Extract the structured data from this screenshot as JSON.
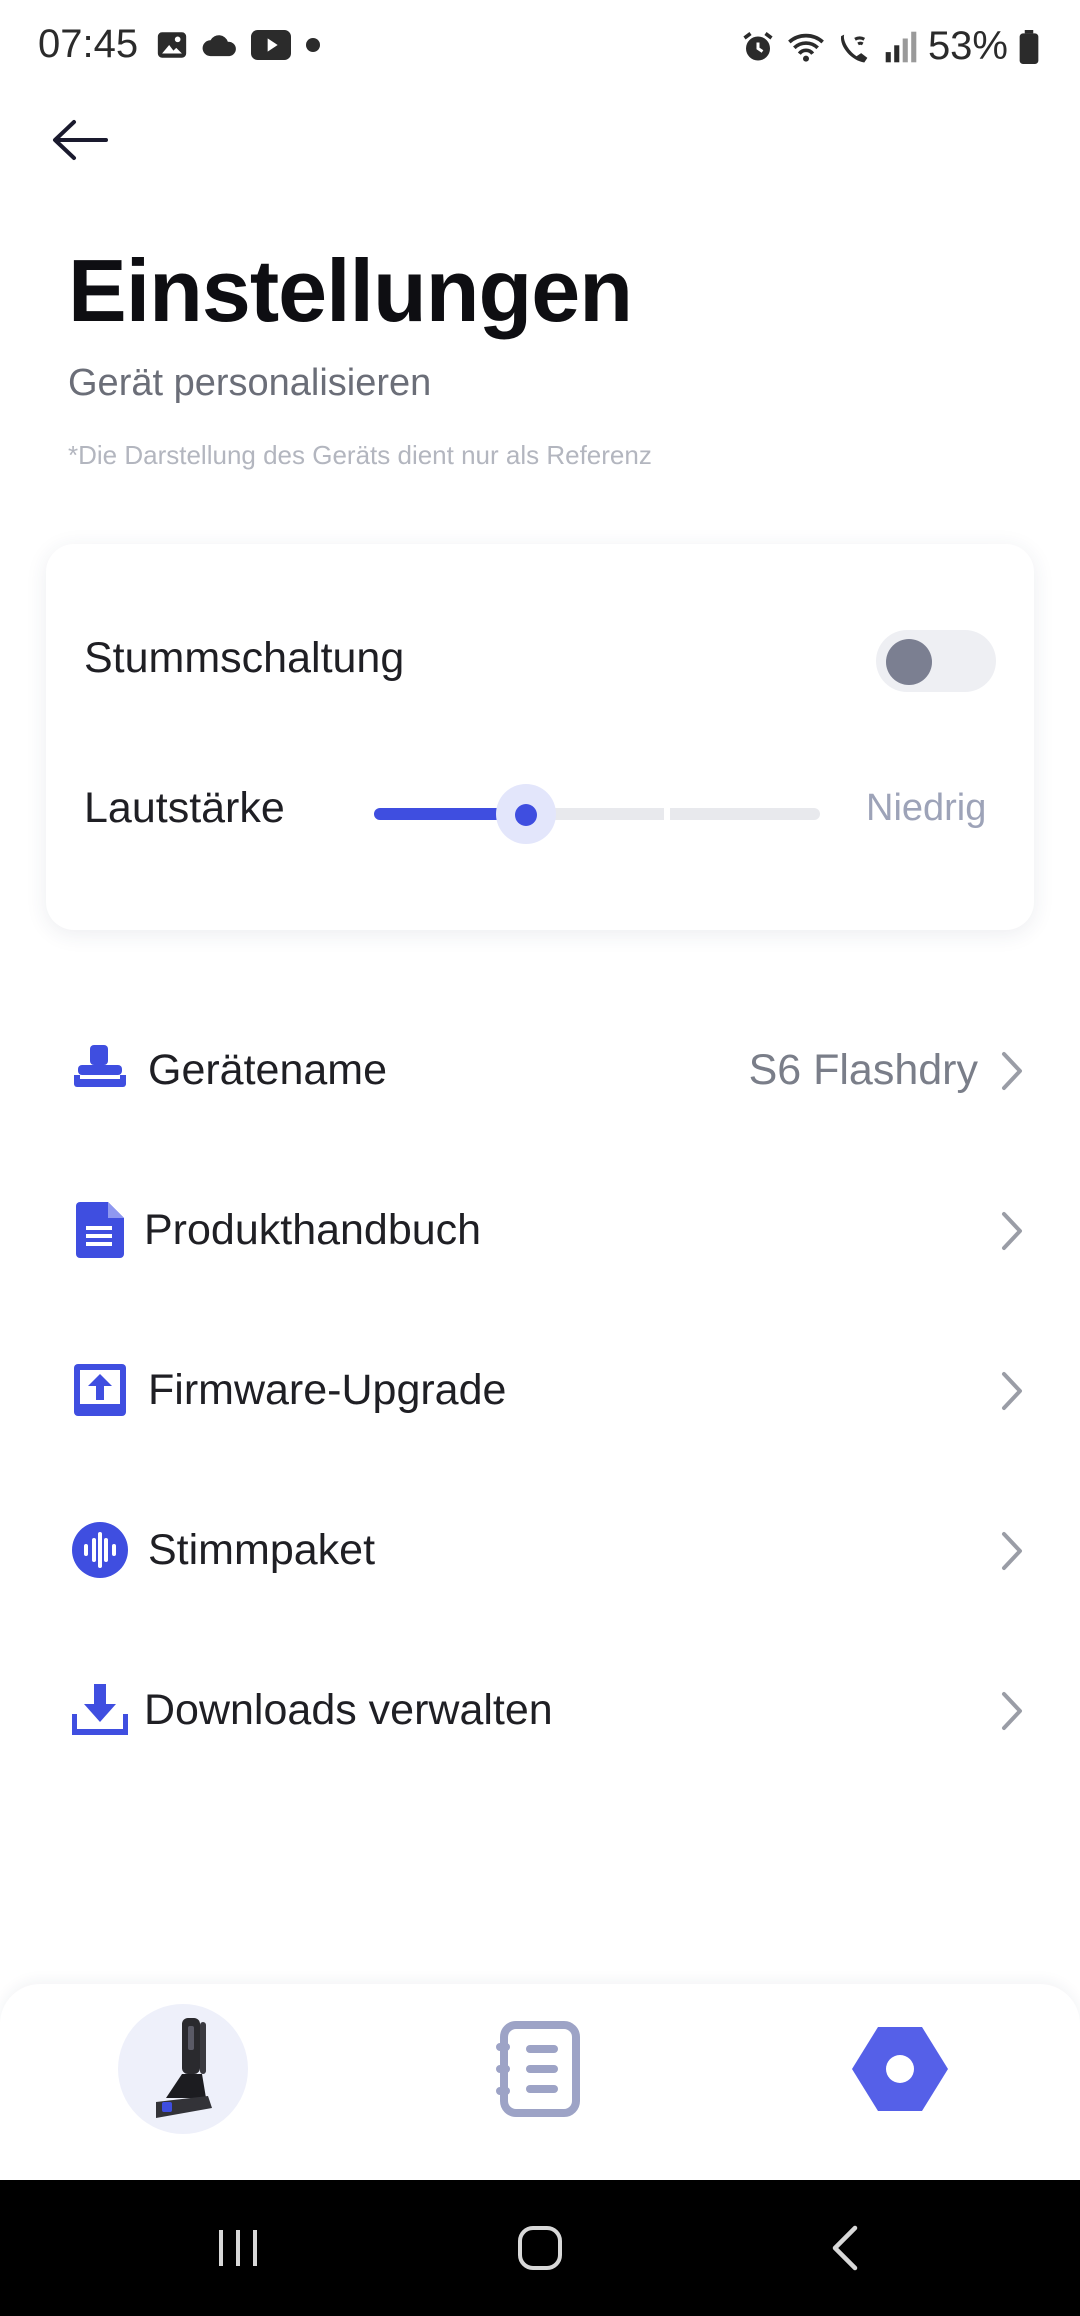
{
  "status_bar": {
    "time": "07:45",
    "left_icons": [
      "image-icon",
      "cloud-icon",
      "youtube-icon",
      "dot-icon"
    ],
    "right_icons": [
      "alarm-icon",
      "wifi-icon",
      "wifi-calling-icon",
      "signal-icon",
      "battery-icon"
    ],
    "battery": "53%"
  },
  "header": {
    "back_icon": "arrow-left-icon",
    "title": "Einstellungen",
    "subtitle": "Gerät personalisieren",
    "note": "*Die Darstellung des Geräts dient nur als Referenz"
  },
  "sound_card": {
    "mute_label": "Stummschaltung",
    "mute_on": false,
    "volume_label": "Lautstärke",
    "volume_value": "Niedrig",
    "volume_level": 0.34,
    "accent_color": "#3f4ee0"
  },
  "menu": [
    {
      "icon": "vacuum-device-icon",
      "label": "Gerätename",
      "value": "S6 Flashdry"
    },
    {
      "icon": "document-icon",
      "label": "Produkthandbuch",
      "value": ""
    },
    {
      "icon": "upload-icon",
      "label": "Firmware-Upgrade",
      "value": ""
    },
    {
      "icon": "voice-wave-icon",
      "label": "Stimmpaket",
      "value": ""
    },
    {
      "icon": "download-icon",
      "label": "Downloads verwalten",
      "value": ""
    }
  ],
  "bottom_nav": [
    {
      "icon": "vacuum-device-icon",
      "active": false
    },
    {
      "icon": "notebook-icon",
      "active": false
    },
    {
      "icon": "settings-hexagon-icon",
      "active": true
    }
  ],
  "system_nav": [
    "recent-apps-icon",
    "home-icon",
    "back-icon"
  ]
}
